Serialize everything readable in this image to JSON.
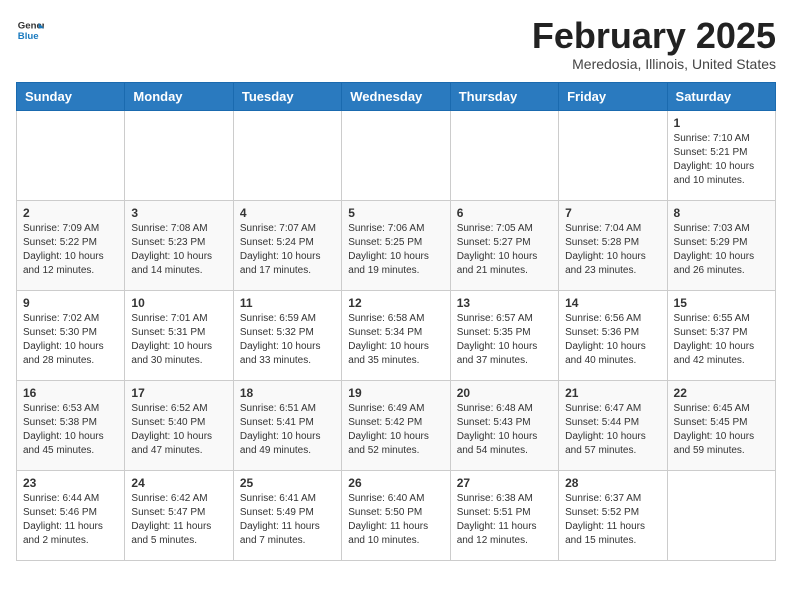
{
  "header": {
    "logo": {
      "general": "General",
      "blue": "Blue"
    },
    "title": "February 2025",
    "subtitle": "Meredosia, Illinois, United States"
  },
  "weekdays": [
    "Sunday",
    "Monday",
    "Tuesday",
    "Wednesday",
    "Thursday",
    "Friday",
    "Saturday"
  ],
  "weeks": [
    [
      {
        "day": "",
        "info": ""
      },
      {
        "day": "",
        "info": ""
      },
      {
        "day": "",
        "info": ""
      },
      {
        "day": "",
        "info": ""
      },
      {
        "day": "",
        "info": ""
      },
      {
        "day": "",
        "info": ""
      },
      {
        "day": "1",
        "info": "Sunrise: 7:10 AM\nSunset: 5:21 PM\nDaylight: 10 hours\nand 10 minutes."
      }
    ],
    [
      {
        "day": "2",
        "info": "Sunrise: 7:09 AM\nSunset: 5:22 PM\nDaylight: 10 hours\nand 12 minutes."
      },
      {
        "day": "3",
        "info": "Sunrise: 7:08 AM\nSunset: 5:23 PM\nDaylight: 10 hours\nand 14 minutes."
      },
      {
        "day": "4",
        "info": "Sunrise: 7:07 AM\nSunset: 5:24 PM\nDaylight: 10 hours\nand 17 minutes."
      },
      {
        "day": "5",
        "info": "Sunrise: 7:06 AM\nSunset: 5:25 PM\nDaylight: 10 hours\nand 19 minutes."
      },
      {
        "day": "6",
        "info": "Sunrise: 7:05 AM\nSunset: 5:27 PM\nDaylight: 10 hours\nand 21 minutes."
      },
      {
        "day": "7",
        "info": "Sunrise: 7:04 AM\nSunset: 5:28 PM\nDaylight: 10 hours\nand 23 minutes."
      },
      {
        "day": "8",
        "info": "Sunrise: 7:03 AM\nSunset: 5:29 PM\nDaylight: 10 hours\nand 26 minutes."
      }
    ],
    [
      {
        "day": "9",
        "info": "Sunrise: 7:02 AM\nSunset: 5:30 PM\nDaylight: 10 hours\nand 28 minutes."
      },
      {
        "day": "10",
        "info": "Sunrise: 7:01 AM\nSunset: 5:31 PM\nDaylight: 10 hours\nand 30 minutes."
      },
      {
        "day": "11",
        "info": "Sunrise: 6:59 AM\nSunset: 5:32 PM\nDaylight: 10 hours\nand 33 minutes."
      },
      {
        "day": "12",
        "info": "Sunrise: 6:58 AM\nSunset: 5:34 PM\nDaylight: 10 hours\nand 35 minutes."
      },
      {
        "day": "13",
        "info": "Sunrise: 6:57 AM\nSunset: 5:35 PM\nDaylight: 10 hours\nand 37 minutes."
      },
      {
        "day": "14",
        "info": "Sunrise: 6:56 AM\nSunset: 5:36 PM\nDaylight: 10 hours\nand 40 minutes."
      },
      {
        "day": "15",
        "info": "Sunrise: 6:55 AM\nSunset: 5:37 PM\nDaylight: 10 hours\nand 42 minutes."
      }
    ],
    [
      {
        "day": "16",
        "info": "Sunrise: 6:53 AM\nSunset: 5:38 PM\nDaylight: 10 hours\nand 45 minutes."
      },
      {
        "day": "17",
        "info": "Sunrise: 6:52 AM\nSunset: 5:40 PM\nDaylight: 10 hours\nand 47 minutes."
      },
      {
        "day": "18",
        "info": "Sunrise: 6:51 AM\nSunset: 5:41 PM\nDaylight: 10 hours\nand 49 minutes."
      },
      {
        "day": "19",
        "info": "Sunrise: 6:49 AM\nSunset: 5:42 PM\nDaylight: 10 hours\nand 52 minutes."
      },
      {
        "day": "20",
        "info": "Sunrise: 6:48 AM\nSunset: 5:43 PM\nDaylight: 10 hours\nand 54 minutes."
      },
      {
        "day": "21",
        "info": "Sunrise: 6:47 AM\nSunset: 5:44 PM\nDaylight: 10 hours\nand 57 minutes."
      },
      {
        "day": "22",
        "info": "Sunrise: 6:45 AM\nSunset: 5:45 PM\nDaylight: 10 hours\nand 59 minutes."
      }
    ],
    [
      {
        "day": "23",
        "info": "Sunrise: 6:44 AM\nSunset: 5:46 PM\nDaylight: 11 hours\nand 2 minutes."
      },
      {
        "day": "24",
        "info": "Sunrise: 6:42 AM\nSunset: 5:47 PM\nDaylight: 11 hours\nand 5 minutes."
      },
      {
        "day": "25",
        "info": "Sunrise: 6:41 AM\nSunset: 5:49 PM\nDaylight: 11 hours\nand 7 minutes."
      },
      {
        "day": "26",
        "info": "Sunrise: 6:40 AM\nSunset: 5:50 PM\nDaylight: 11 hours\nand 10 minutes."
      },
      {
        "day": "27",
        "info": "Sunrise: 6:38 AM\nSunset: 5:51 PM\nDaylight: 11 hours\nand 12 minutes."
      },
      {
        "day": "28",
        "info": "Sunrise: 6:37 AM\nSunset: 5:52 PM\nDaylight: 11 hours\nand 15 minutes."
      },
      {
        "day": "",
        "info": ""
      }
    ]
  ]
}
